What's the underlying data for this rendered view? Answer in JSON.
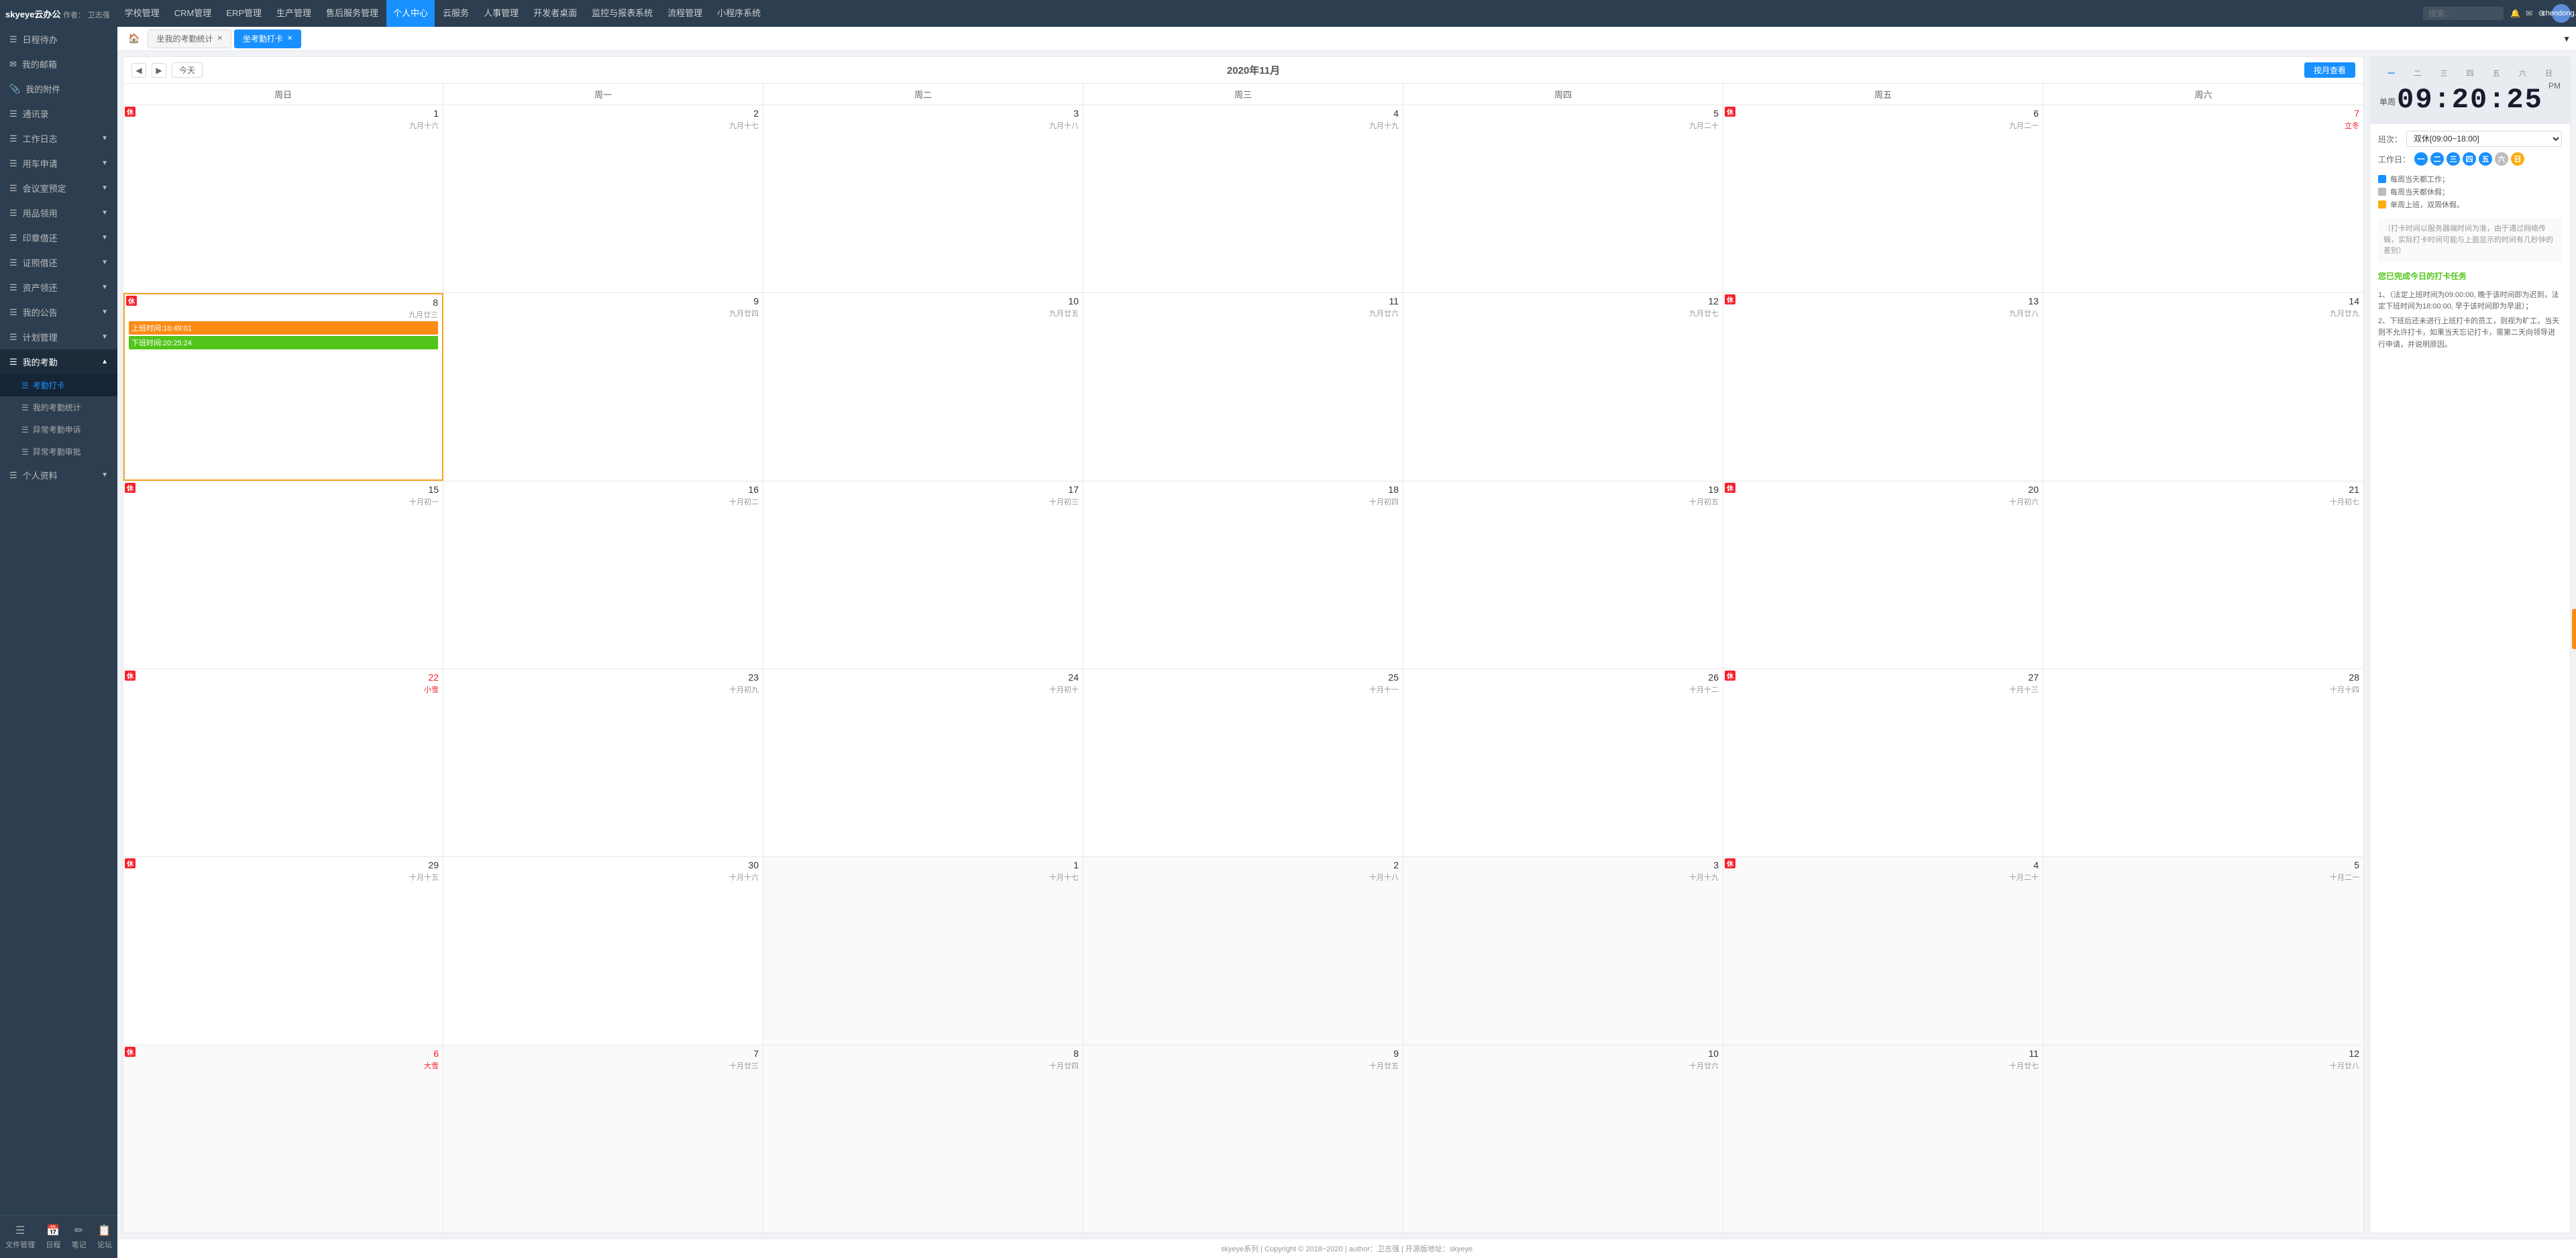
{
  "app": {
    "name": "skyeye云办公",
    "author_label": "作者：",
    "author": "卫志强"
  },
  "topnav": {
    "menu_items": [
      {
        "label": "学校管理",
        "active": false
      },
      {
        "label": "CRM管理",
        "active": false
      },
      {
        "label": "ERP管理",
        "active": false
      },
      {
        "label": "生产管理",
        "active": false
      },
      {
        "label": "售后服务管理",
        "active": false
      },
      {
        "label": "个人中心",
        "active": true
      },
      {
        "label": "云服务",
        "active": false
      },
      {
        "label": "人事管理",
        "active": false
      },
      {
        "label": "开发者桌面",
        "active": false
      },
      {
        "label": "监控与报表系统",
        "active": false
      },
      {
        "label": "流程管理",
        "active": false
      },
      {
        "label": "小程序系统",
        "active": false
      }
    ],
    "search_placeholder": "搜索...",
    "user": "chendong..."
  },
  "sidebar": {
    "items": [
      {
        "label": "日程待办",
        "icon": "☰",
        "has_sub": false
      },
      {
        "label": "我的邮箱",
        "icon": "✉",
        "has_sub": false
      },
      {
        "label": "我的附件",
        "icon": "📎",
        "has_sub": false
      },
      {
        "label": "通讯录",
        "icon": "☰",
        "has_sub": false
      },
      {
        "label": "工作日志",
        "icon": "☰",
        "has_sub": true
      },
      {
        "label": "用车申请",
        "icon": "☰",
        "has_sub": true
      },
      {
        "label": "会议室预定",
        "icon": "☰",
        "has_sub": true
      },
      {
        "label": "用品领用",
        "icon": "☰",
        "has_sub": true
      },
      {
        "label": "印章借还",
        "icon": "☰",
        "has_sub": true
      },
      {
        "label": "证照借还",
        "icon": "☰",
        "has_sub": true
      },
      {
        "label": "资产领还",
        "icon": "☰",
        "has_sub": true
      },
      {
        "label": "我的公告",
        "icon": "☰",
        "has_sub": true
      },
      {
        "label": "计划管理",
        "icon": "☰",
        "has_sub": true
      },
      {
        "label": "我的考勤",
        "icon": "☰",
        "has_sub": true,
        "active": true,
        "expanded": true
      },
      {
        "label": "个人资料",
        "icon": "☰",
        "has_sub": true
      }
    ],
    "sub_items": [
      {
        "label": "考勤打卡",
        "active": true
      },
      {
        "label": "我的考勤统计",
        "active": false
      },
      {
        "label": "异常考勤申诉",
        "active": false
      },
      {
        "label": "异常考勤审批",
        "active": false
      }
    ],
    "bottom": [
      {
        "label": "文件管理",
        "icon": "☰"
      },
      {
        "label": "日程",
        "icon": "📅"
      },
      {
        "label": "笔记",
        "icon": "✏"
      },
      {
        "label": "论坛",
        "icon": "📋"
      }
    ]
  },
  "tabs": {
    "home_icon": "🏠",
    "items": [
      {
        "label": "坐我的考勤统计",
        "active": false,
        "closable": true
      },
      {
        "label": "坐考勤打卡",
        "active": true,
        "closable": true
      }
    ],
    "dropdown_label": "▼"
  },
  "calendar": {
    "title": "2020年11月",
    "prev_btn": "◀",
    "next_btn": "▶",
    "today_btn": "今天",
    "month_view_btn": "按月查看",
    "weekdays": [
      "周日",
      "周一",
      "周二",
      "周三",
      "周四",
      "周五",
      "周六"
    ],
    "weeks": [
      [
        {
          "day": "1",
          "lunar": "九月十六",
          "is_rest": true,
          "is_other_month": false,
          "is_today": false,
          "solar_term": "",
          "holiday_color": false
        },
        {
          "day": "2",
          "lunar": "九月十七",
          "is_rest": false,
          "is_other_month": false,
          "is_today": false,
          "solar_term": "",
          "holiday_color": false
        },
        {
          "day": "3",
          "lunar": "九月十八",
          "is_rest": false,
          "is_other_month": false,
          "is_today": false,
          "solar_term": "",
          "holiday_color": false
        },
        {
          "day": "4",
          "lunar": "九月十九",
          "is_rest": false,
          "is_other_month": false,
          "is_today": false,
          "solar_term": "",
          "holiday_color": false
        },
        {
          "day": "5",
          "lunar": "九月二十",
          "is_rest": false,
          "is_other_month": false,
          "is_today": false,
          "solar_term": "",
          "holiday_color": false
        },
        {
          "day": "6",
          "lunar": "九月二一",
          "is_rest": true,
          "is_other_month": false,
          "is_today": false,
          "solar_term": "",
          "holiday_color": false
        },
        {
          "day": "7",
          "lunar": "立冬",
          "is_rest": false,
          "is_other_month": false,
          "is_today": false,
          "solar_term": "立冬",
          "holiday_color": true
        }
      ],
      [
        {
          "day": "8",
          "lunar": "九月廿三",
          "is_rest": true,
          "is_other_month": false,
          "is_today": true,
          "solar_term": "",
          "holiday_color": false,
          "punch_in": "上班时间:16:49:01",
          "punch_out": "下班时间:20:25:24"
        },
        {
          "day": "9",
          "lunar": "九月廿四",
          "is_rest": false,
          "is_other_month": false,
          "is_today": false,
          "solar_term": "",
          "holiday_color": false
        },
        {
          "day": "10",
          "lunar": "九月廿五",
          "is_rest": false,
          "is_other_month": false,
          "is_today": false,
          "solar_term": "",
          "holiday_color": false
        },
        {
          "day": "11",
          "lunar": "九月廿六",
          "is_rest": false,
          "is_other_month": false,
          "is_today": false,
          "solar_term": "",
          "holiday_color": false
        },
        {
          "day": "12",
          "lunar": "九月廿七",
          "is_rest": false,
          "is_other_month": false,
          "is_today": false,
          "solar_term": "",
          "holiday_color": false
        },
        {
          "day": "13",
          "lunar": "九月廿八",
          "is_rest": true,
          "is_other_month": false,
          "is_today": false,
          "solar_term": "",
          "holiday_color": false
        },
        {
          "day": "14",
          "lunar": "九月廿九",
          "is_rest": false,
          "is_other_month": false,
          "is_today": false,
          "solar_term": "",
          "holiday_color": false
        }
      ],
      [
        {
          "day": "15",
          "lunar": "十月初一",
          "is_rest": true,
          "is_other_month": false,
          "is_today": false,
          "solar_term": "",
          "holiday_color": false
        },
        {
          "day": "16",
          "lunar": "十月初二",
          "is_rest": false,
          "is_other_month": false,
          "is_today": false,
          "solar_term": "",
          "holiday_color": false
        },
        {
          "day": "17",
          "lunar": "十月初三",
          "is_rest": false,
          "is_other_month": false,
          "is_today": false,
          "solar_term": "",
          "holiday_color": false
        },
        {
          "day": "18",
          "lunar": "十月初四",
          "is_rest": false,
          "is_other_month": false,
          "is_today": false,
          "solar_term": "",
          "holiday_color": false
        },
        {
          "day": "19",
          "lunar": "十月初五",
          "is_rest": false,
          "is_other_month": false,
          "is_today": false,
          "solar_term": "",
          "holiday_color": false
        },
        {
          "day": "20",
          "lunar": "十月初六",
          "is_rest": true,
          "is_other_month": false,
          "is_today": false,
          "solar_term": "",
          "holiday_color": false
        },
        {
          "day": "21",
          "lunar": "十月初七",
          "is_rest": false,
          "is_other_month": false,
          "is_today": false,
          "solar_term": "",
          "holiday_color": false
        }
      ],
      [
        {
          "day": "22",
          "lunar": "小雪",
          "is_rest": true,
          "is_other_month": false,
          "is_today": false,
          "solar_term": "小雪",
          "holiday_color": true
        },
        {
          "day": "23",
          "lunar": "十月初九",
          "is_rest": false,
          "is_other_month": false,
          "is_today": false,
          "solar_term": "",
          "holiday_color": false
        },
        {
          "day": "24",
          "lunar": "十月初十",
          "is_rest": false,
          "is_other_month": false,
          "is_today": false,
          "solar_term": "",
          "holiday_color": false
        },
        {
          "day": "25",
          "lunar": "十月十一",
          "is_rest": false,
          "is_other_month": false,
          "is_today": false,
          "solar_term": "",
          "holiday_color": false
        },
        {
          "day": "26",
          "lunar": "十月十二",
          "is_rest": false,
          "is_other_month": false,
          "is_today": false,
          "solar_term": "",
          "holiday_color": false
        },
        {
          "day": "27",
          "lunar": "十月十三",
          "is_rest": true,
          "is_other_month": false,
          "is_today": false,
          "solar_term": "",
          "holiday_color": false
        },
        {
          "day": "28",
          "lunar": "十月十四",
          "is_rest": false,
          "is_other_month": false,
          "is_today": false,
          "solar_term": "",
          "holiday_color": false
        }
      ],
      [
        {
          "day": "29",
          "lunar": "十月十五",
          "is_rest": true,
          "is_other_month": false,
          "is_today": false,
          "solar_term": "",
          "holiday_color": false
        },
        {
          "day": "30",
          "lunar": "十月十六",
          "is_rest": false,
          "is_other_month": false,
          "is_today": false,
          "solar_term": "",
          "holiday_color": false
        },
        {
          "day": "1",
          "lunar": "十月十七",
          "is_rest": false,
          "is_other_month": true,
          "is_today": false,
          "solar_term": "",
          "holiday_color": false
        },
        {
          "day": "2",
          "lunar": "十月十八",
          "is_rest": false,
          "is_other_month": true,
          "is_today": false,
          "solar_term": "",
          "holiday_color": false
        },
        {
          "day": "3",
          "lunar": "十月十九",
          "is_rest": false,
          "is_other_month": true,
          "is_today": false,
          "solar_term": "",
          "holiday_color": false
        },
        {
          "day": "4",
          "lunar": "十月二十",
          "is_rest": true,
          "is_other_month": true,
          "is_today": false,
          "solar_term": "",
          "holiday_color": false
        },
        {
          "day": "5",
          "lunar": "十月二一",
          "is_rest": false,
          "is_other_month": true,
          "is_today": false,
          "solar_term": "",
          "holiday_color": false
        }
      ],
      [
        {
          "day": "6",
          "lunar": "大雪",
          "is_rest": true,
          "is_other_month": true,
          "is_today": false,
          "solar_term": "大雪",
          "holiday_color": true
        },
        {
          "day": "7",
          "lunar": "十月廿三",
          "is_rest": false,
          "is_other_month": true,
          "is_today": false,
          "solar_term": "",
          "holiday_color": false
        },
        {
          "day": "8",
          "lunar": "十月廿四",
          "is_rest": false,
          "is_other_month": true,
          "is_today": false,
          "solar_term": "",
          "holiday_color": false
        },
        {
          "day": "9",
          "lunar": "十月廿五",
          "is_rest": false,
          "is_other_month": true,
          "is_today": false,
          "solar_term": "",
          "holiday_color": false
        },
        {
          "day": "10",
          "lunar": "十月廿六",
          "is_rest": false,
          "is_other_month": true,
          "is_today": false,
          "solar_term": "",
          "holiday_color": false
        },
        {
          "day": "11",
          "lunar": "十月廿七",
          "is_rest": false,
          "is_other_month": true,
          "is_today": false,
          "solar_term": "",
          "holiday_color": false
        },
        {
          "day": "12",
          "lunar": "十月廿八",
          "is_rest": false,
          "is_other_month": true,
          "is_today": false,
          "solar_term": "",
          "holiday_color": false
        }
      ]
    ]
  },
  "right_panel": {
    "weekdays": [
      "一",
      "二",
      "三",
      "四",
      "五",
      "六",
      "日"
    ],
    "active_weekday_index": 0,
    "clock_time": "09:20:25",
    "clock_period": "PM",
    "clock_mode": "单周",
    "shift_label": "班次：",
    "shift_value": "双休[09:00~18:00]",
    "workday_label": "工作日：",
    "workdays": [
      "一",
      "二",
      "三",
      "四",
      "五"
    ],
    "restdays": [
      "六"
    ],
    "special_days": [
      "日"
    ],
    "legend": [
      {
        "color": "blue",
        "text": "每周当天都工作；"
      },
      {
        "color": "gray",
        "text": "每周当天都休假；"
      },
      {
        "color": "yellow",
        "text": "单周上班，双周休假。"
      }
    ],
    "clock_note": "（打卡时间以服务器端时间为准，由于通过网络传输，实际打卡时间可能与上面显示的时间有几秒钟的差别）",
    "task_done": "您已完成今日的打卡任务",
    "task_notes": [
      "1、（法定上班时间为09:00:00, 晚于该时间即为迟到，法定下班时间为18:00:00, 早于该时间即为早退）；",
      "2、下班后还未进行上班打卡的员工，则视为旷工，当天则不允许打卡，如果当天忘记打卡，需第二天向领导进行申请，并说明原因。"
    ]
  },
  "footer": {
    "text": "skyeye系列 | Copyright © 2018~2020 | author：卫志强 | 开源版地址：skyeye"
  }
}
